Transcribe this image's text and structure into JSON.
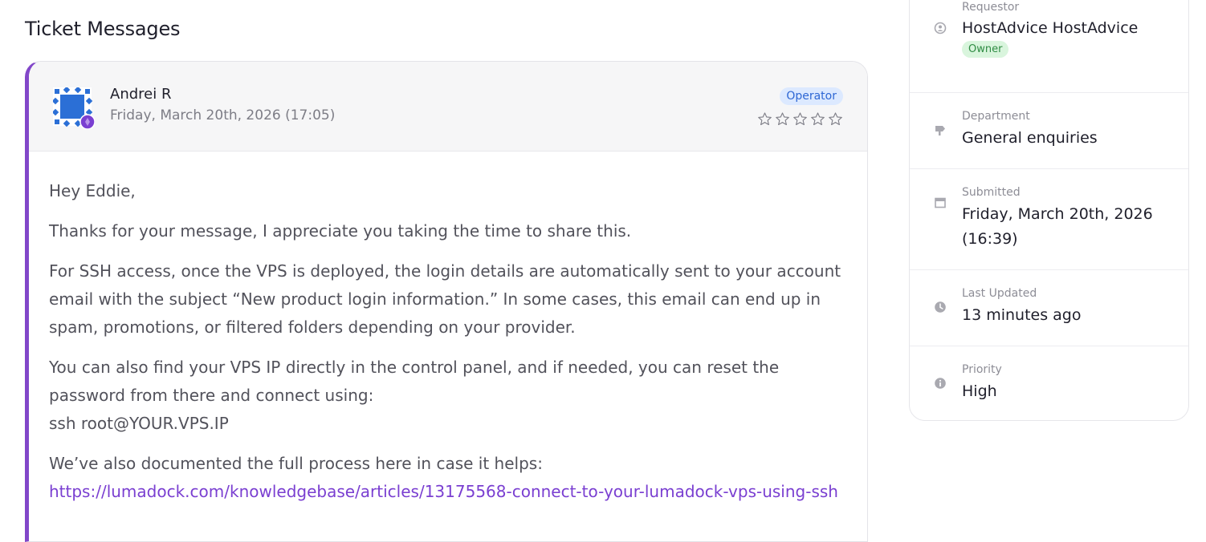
{
  "section": {
    "title": "Ticket Messages"
  },
  "message": {
    "author": "Andrei R",
    "date": "Friday, March 20th, 2026 (17:05)",
    "role_badge": "Operator",
    "rating_stars": 5,
    "rating_value": 0,
    "greeting": "Hey Eddie,",
    "para1": "Thanks for your message, I appreciate you taking the time to share this.",
    "para2": "For SSH access, once the VPS is deployed, the login details are automatically sent to your account email with the subject “New product login information.” In some cases, this email can end up in spam, promotions, or filtered folders depending on your provider.",
    "para3_line1": "You can also find your VPS IP directly in the control panel, and if needed, you can reset the password from there and connect using:",
    "para3_line2": "ssh root@YOUR.VPS.IP",
    "para4_intro": "We’ve also documented the full process here in case it helps:",
    "para4_link": "https://lumadock.com/knowledgebase/articles/13175568-connect-to-your-lumadock-vps-using-ssh"
  },
  "sidebar": {
    "requestor": {
      "label": "Requestor",
      "value": "HostAdvice HostAdvice",
      "badge": "Owner",
      "icon": "user-circle-icon"
    },
    "department": {
      "label": "Department",
      "value": "General enquiries",
      "icon": "signpost-icon"
    },
    "submitted": {
      "label": "Submitted",
      "value": "Friday, March 20th, 2026 (16:39)",
      "icon": "calendar-icon"
    },
    "last_updated": {
      "label": "Last Updated",
      "value": "13 minutes ago",
      "icon": "clock-icon"
    },
    "priority": {
      "label": "Priority",
      "value": "High",
      "icon": "info-icon"
    }
  },
  "colors": {
    "accent": "#8247c9",
    "operator_badge_bg": "#dce9ff",
    "owner_badge_bg": "#d9f5dd",
    "link": "#7a3fd1"
  }
}
